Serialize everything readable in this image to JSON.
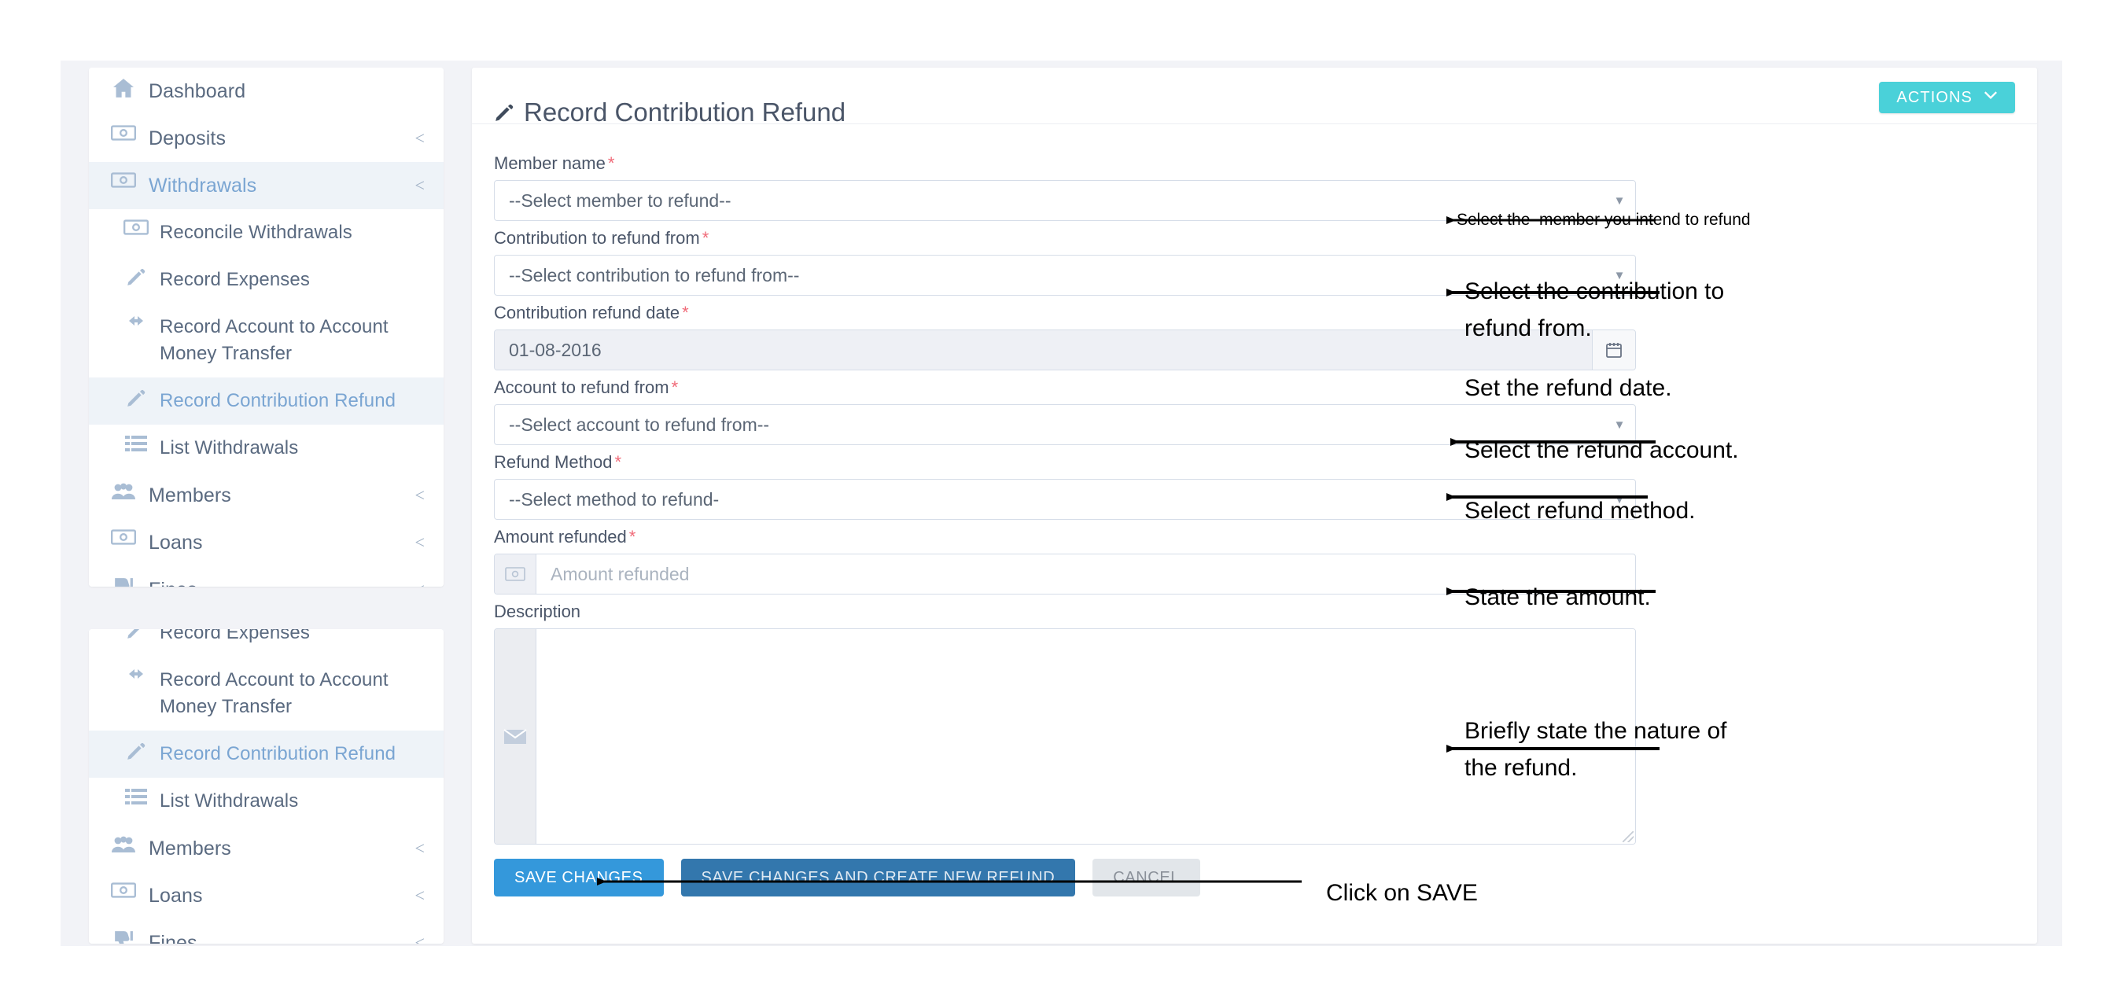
{
  "sidebar": {
    "top_items": [
      {
        "label": "Dashboard",
        "icon": "home-icon",
        "chevron": "",
        "active": false,
        "child": false
      },
      {
        "label": "Deposits",
        "icon": "banknote-icon",
        "chevron": "<",
        "active": false,
        "child": false
      },
      {
        "label": "Withdrawals",
        "icon": "banknote-icon",
        "chevron": "<",
        "active": true,
        "child": false
      },
      {
        "label": "Reconcile Withdrawals",
        "icon": "banknote-icon",
        "chevron": "",
        "active": false,
        "child": true
      },
      {
        "label": "Record Expenses",
        "icon": "pencil-icon",
        "chevron": "",
        "active": false,
        "child": true
      },
      {
        "label": "Record Account to Account Money Transfer",
        "icon": "arrows-horizontal-icon",
        "chevron": "",
        "active": false,
        "child": true
      },
      {
        "label": "Record Contribution Refund",
        "icon": "pencil-icon",
        "chevron": "",
        "active": true,
        "child": true
      },
      {
        "label": "List Withdrawals",
        "icon": "list-icon",
        "chevron": "",
        "active": false,
        "child": true
      },
      {
        "label": "Members",
        "icon": "users-icon",
        "chevron": "<",
        "active": false,
        "child": false
      },
      {
        "label": "Loans",
        "icon": "banknote-icon",
        "chevron": "<",
        "active": false,
        "child": false
      },
      {
        "label": "Fines",
        "icon": "thumbs-down-icon",
        "chevron": "<",
        "active": false,
        "child": false
      }
    ],
    "bottom_items": [
      {
        "label": "Record Expenses",
        "icon": "pencil-icon",
        "chevron": "",
        "active": false,
        "child": true
      },
      {
        "label": "Record Account to Account Money Transfer",
        "icon": "arrows-horizontal-icon",
        "chevron": "",
        "active": false,
        "child": true
      },
      {
        "label": "Record Contribution Refund",
        "icon": "pencil-icon",
        "chevron": "",
        "active": true,
        "child": true
      },
      {
        "label": "List Withdrawals",
        "icon": "list-icon",
        "chevron": "",
        "active": false,
        "child": true
      },
      {
        "label": "Members",
        "icon": "users-icon",
        "chevron": "<",
        "active": false,
        "child": false
      },
      {
        "label": "Loans",
        "icon": "banknote-icon",
        "chevron": "<",
        "active": false,
        "child": false
      },
      {
        "label": "Fines",
        "icon": "thumbs-down-icon",
        "chevron": "<",
        "active": false,
        "child": false
      }
    ]
  },
  "header": {
    "title": "Record Contribution Refund",
    "actions_label": "ACTIONS",
    "actions_caret": "⌄",
    "accent_color": "#4ad1d9"
  },
  "form": {
    "member_name": {
      "label": "Member name",
      "required": "*",
      "value": "--Select member to refund--"
    },
    "contribution_from": {
      "label": "Contribution to refund from",
      "required": "*",
      "value": "--Select contribution to refund from--"
    },
    "refund_date": {
      "label": "Contribution refund date",
      "required": "*",
      "value": "01-08-2016"
    },
    "account_from": {
      "label": "Account to refund from",
      "required": "*",
      "value": "--Select account to refund from--"
    },
    "refund_method": {
      "label": "Refund Method",
      "required": "*",
      "value": "--Select method to refund-"
    },
    "amount": {
      "label": "Amount refunded",
      "required": "*",
      "placeholder": "Amount refunded",
      "value": ""
    },
    "description": {
      "label": "Description",
      "required": "",
      "value": ""
    }
  },
  "buttons": {
    "save": "SAVE CHANGES",
    "save_new": "SAVE CHANGES AND CREATE NEW REFUND",
    "cancel": "CANCEL"
  },
  "annotations": {
    "a1": "Select the  member you intend to refund",
    "a2": "Select the contribution to\nrefund from.",
    "a3": "Set the refund date.",
    "a4": "Select the refund account.",
    "a5": "Select refund method.",
    "a6": "State the amount.",
    "a7": "Briefly state the nature of\nthe refund.",
    "a8": "Click on SAVE"
  }
}
